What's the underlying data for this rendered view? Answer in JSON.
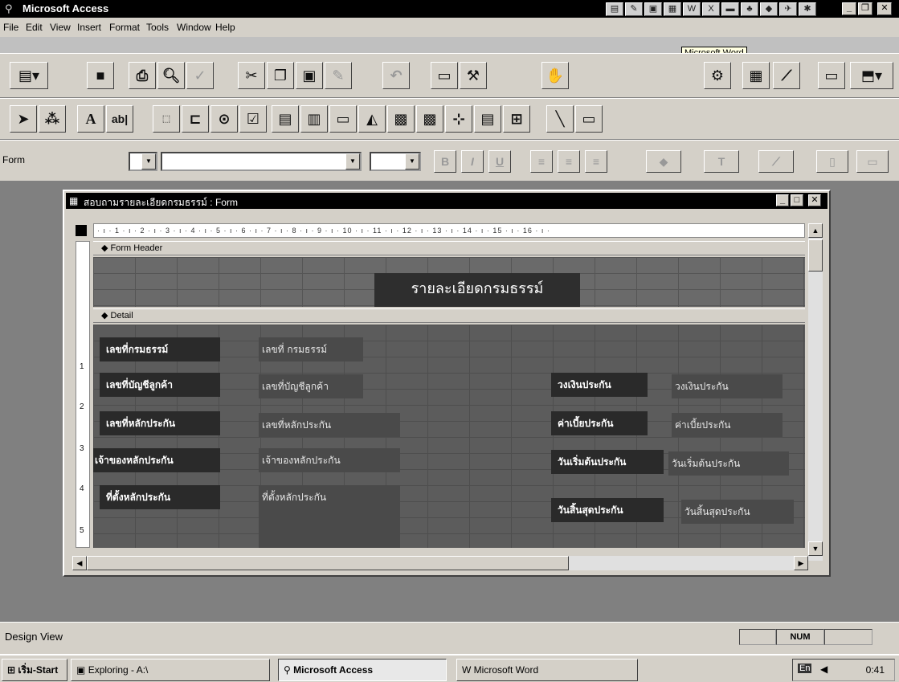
{
  "app": {
    "title": "Microsoft Access",
    "tooltip": "Microsoft Word"
  },
  "menu": [
    "File",
    "Edit",
    "View",
    "Insert",
    "Format",
    "Tools",
    "Window",
    "Help"
  ],
  "formatting": {
    "object_combo": "Form",
    "font_combo": "",
    "size_combo": ""
  },
  "form_window": {
    "title": "สอบถามรายละเอียดกรมธรรม์ : Form",
    "ruler": "· ı · 1 · ı · 2 · ı · 3 · ı · 4 · ı · 5 · ı · 6 · ı · 7 · ı · 8 · ı · 9 · ı · 10 · ı · 11 · ı · 12 · ı · 13 · ı · 14 · ı · 15 · ı · 16 · ı ·",
    "vruler": [
      "1",
      "2",
      "3",
      "4",
      "5"
    ],
    "header_section": "Form Header",
    "detail_section": "Detail",
    "heading": "รายละเอียดกรมธรรม์"
  },
  "fields_left": [
    {
      "label": "เลขที่กรมธรรม์",
      "field": "เลขที่ กรมธรรม์"
    },
    {
      "label": "เลขที่บัญชีลูกค้า",
      "field": "เลขที่บัญชีลูกค้า"
    },
    {
      "label": "เลขที่หลักประกัน",
      "field": "เลขที่หลักประกัน"
    },
    {
      "label": "เจ้าของหลักประกัน",
      "field": "เจ้าของหลักประกัน"
    },
    {
      "label": "ที่ตั้งหลักประกัน",
      "field": "ที่ตั้งหลักประกัน"
    }
  ],
  "fields_right": [
    {
      "label": "วงเงินประกัน",
      "field": "วงเงินประกัน"
    },
    {
      "label": "ค่าเบี้ยประกัน",
      "field": "ค่าเบี้ยประกัน"
    },
    {
      "label": "วันเริ่มต้นประกัน",
      "field": "วันเริ่มต้นประกัน"
    },
    {
      "label": "วันสิ้นสุดประกัน",
      "field": "วันสิ้นสุดประกัน"
    }
  ],
  "status": {
    "text": "Design View",
    "num": "NUM"
  },
  "taskbar": {
    "start": "เริ่ม-Start",
    "tasks": [
      "Exploring - A:\\",
      "Microsoft Access",
      "Microsoft Word"
    ],
    "clock": "0:41"
  }
}
